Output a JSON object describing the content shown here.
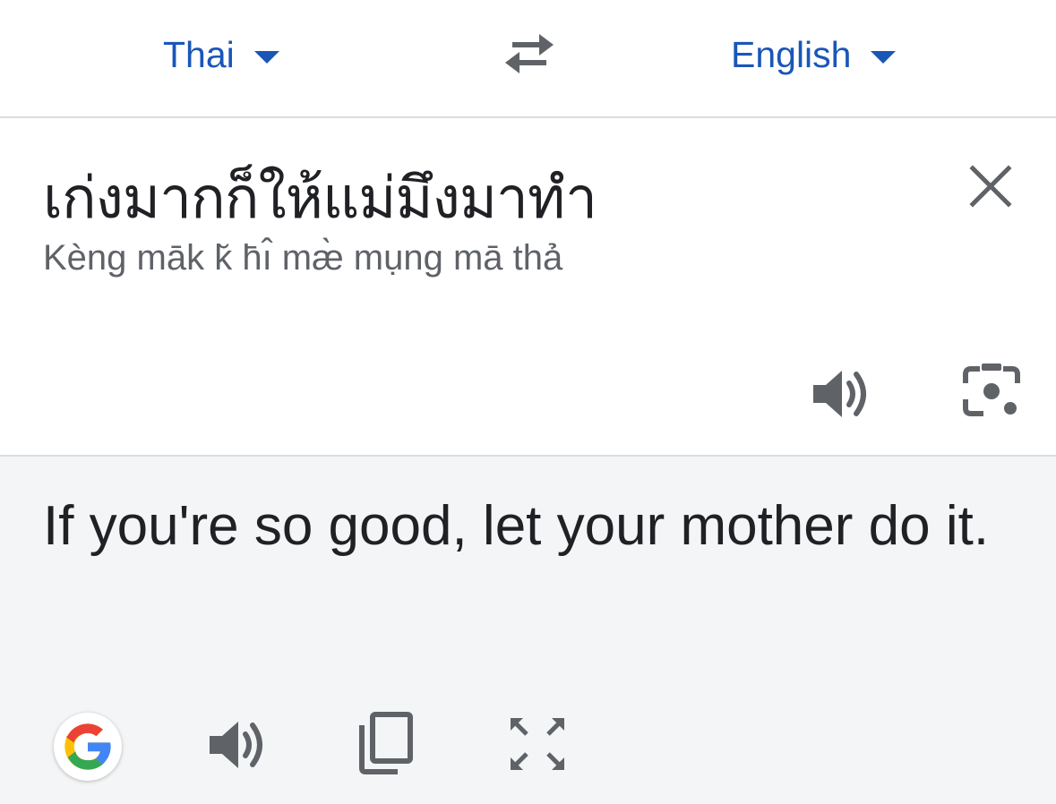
{
  "language_bar": {
    "source_language": "Thai",
    "target_language": "English",
    "swap_icon": "swap-arrows-icon",
    "accent_color": "#1a56b8"
  },
  "source": {
    "text": "เก่งมากก็ให้แม่มึงมาทำ",
    "transliteration": "Kèng māk k̆ h̄ı̂ mæ̀ mụng mā thả",
    "icons": [
      "close-icon",
      "speaker-icon",
      "camera-icon"
    ]
  },
  "translation": {
    "text": "If you're so good, let your mother do it.",
    "icons": [
      "google-logo-icon",
      "speaker-icon",
      "copy-icon",
      "fullscreen-icon"
    ]
  }
}
